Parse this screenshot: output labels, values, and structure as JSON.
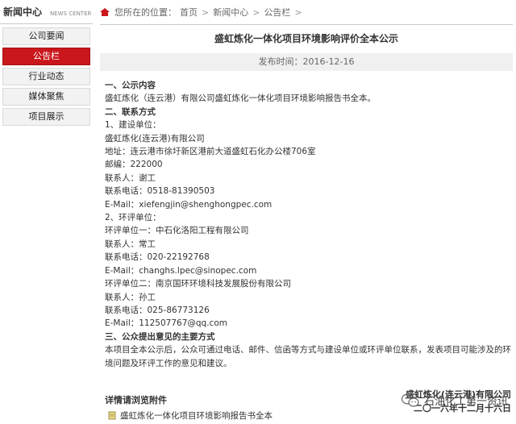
{
  "sidebar": {
    "title": "新闻中心",
    "subtitle": "NEWS CENTER",
    "items": [
      {
        "label": "公司要闻"
      },
      {
        "label": "公告栏"
      },
      {
        "label": "行业动态"
      },
      {
        "label": "媒体聚焦"
      },
      {
        "label": "项目展示"
      }
    ]
  },
  "breadcrumb": {
    "prefix": "您所在的位置：",
    "items": [
      "首页",
      "新闻中心",
      "公告栏"
    ],
    "separator": ">"
  },
  "article": {
    "title": "盛虹炼化一体化项目环境影响评价全本公示",
    "date": "发布时间：2016-12-16",
    "lines": [
      "一、公示内容",
      "盛虹炼化（连云港）有限公司盛虹炼化一体化项目环境影响报告书全本。",
      "二、联系方式",
      "1、建设单位：",
      "盛虹炼化(连云港)有限公司",
      "地址：连云港市徐圩新区港前大道盛虹石化办公楼706室",
      "邮编：222000",
      "联系人：谢工",
      "联系电话：0518-81390503",
      "E-Mail：xiefengjin@shenghongpec.com",
      "2、环评单位：",
      "环评单位一：中石化洛阳工程有限公司",
      "联系人：常工",
      "联系电话：020-22192768",
      "E-Mail：changhs.lpec@sinopec.com",
      "环评单位二：南京国环环境科技发展股份有限公司",
      "联系人：孙工",
      "联系电话：025-86773126",
      "E-Mail：112507767@qq.com",
      "三、公众提出意见的主要方式",
      "本项目全本公示后，公众可通过电话、邮件、信函等方式与建设单位或环评单位联系，发表项目可能涉及的环境问题及环评工作的意见和建议。"
    ],
    "signature_company": "盛虹炼化(连云港)有限公司",
    "signature_date": "二〇一六年十二月十六日"
  },
  "attachments": {
    "heading": "详情请浏览附件",
    "file": "盛虹炼化一体化项目环境影响报告书全本"
  },
  "watermark": {
    "text": "石油化工第一资讯",
    "icon": "wechat-icon"
  },
  "colors": {
    "active": "#c9171c",
    "home_icon": "#c9171c"
  }
}
